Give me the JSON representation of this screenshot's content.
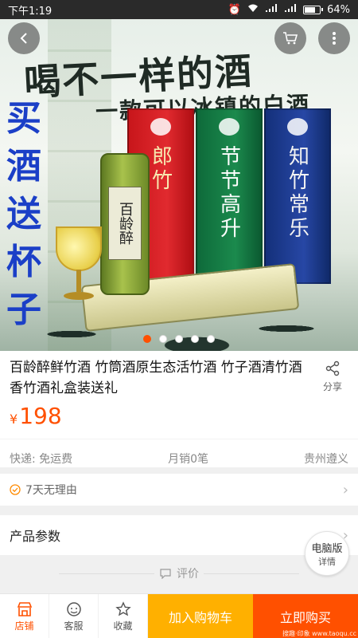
{
  "status_bar": {
    "time": "下午1:19",
    "battery": "64%"
  },
  "hero": {
    "slogan_line1": "喝不一样的酒",
    "slogan_line2": "一款可以冰镇的白酒",
    "promo_vertical": [
      "买",
      "酒",
      "送",
      "杯",
      "子"
    ],
    "boxes": [
      {
        "label": "郎竹",
        "color": "red"
      },
      {
        "label": "节节高升",
        "color": "green"
      },
      {
        "label": "知竹常乐",
        "color": "blue"
      }
    ],
    "bottle_label": "百龄醉",
    "carousel_total": 5,
    "carousel_active": 1
  },
  "product": {
    "title": "百龄醉鲜竹酒 竹筒酒原生态活竹酒 竹子酒清竹酒香竹酒礼盒装送礼",
    "share_label": "分享",
    "price_symbol": "¥",
    "price": "198",
    "shipping": "快递: 免运费",
    "monthly_sales": "月销0笔",
    "location": "贵州遵义"
  },
  "service": {
    "label": "7天无理由"
  },
  "params": {
    "label": "产品参数"
  },
  "review": {
    "label": "评价"
  },
  "desktop_switch": {
    "line1": "电脑版",
    "line2": "详情"
  },
  "bottom_bar": {
    "shop": "店铺",
    "service": "客服",
    "favorite": "收藏",
    "add_to_cart": "加入购物车",
    "buy_now": "立即购买"
  },
  "watermark": "搜趣·印象 www.taoqu.cc",
  "colors": {
    "accent": "#ff5000",
    "cart": "#ffb000",
    "promo_blue": "#1b3fc7"
  }
}
